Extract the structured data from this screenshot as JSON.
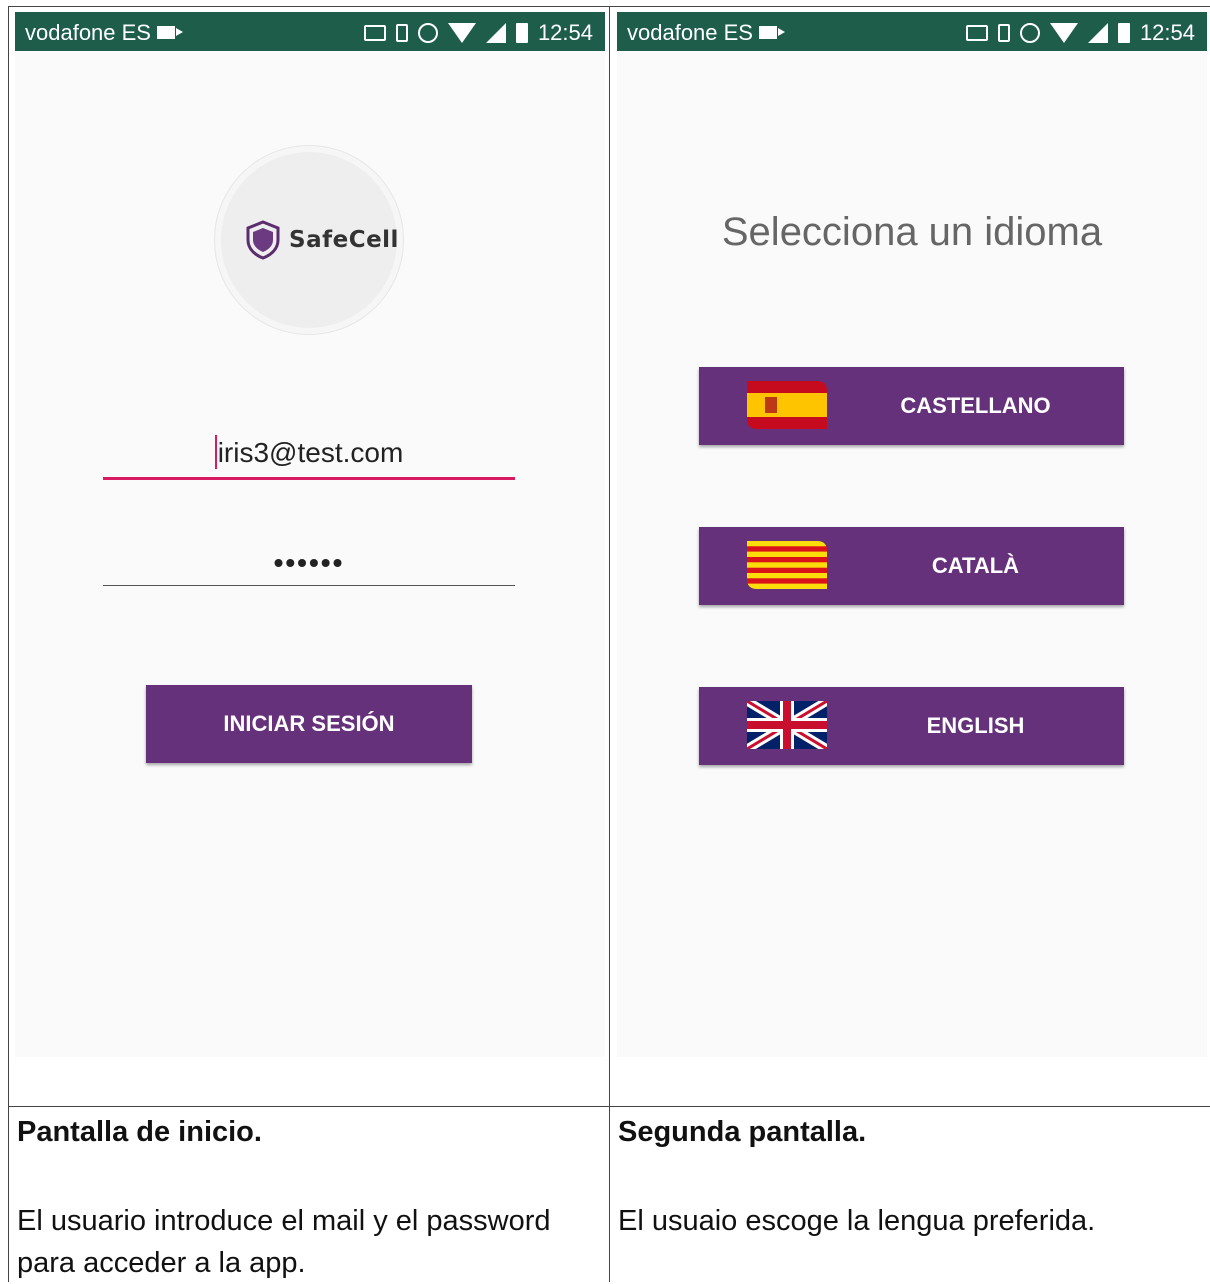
{
  "status_bar": {
    "carrier": "vodafone ES",
    "time": "12:54"
  },
  "login_screen": {
    "logo_text": "SafeCell",
    "email_value": "iris3@test.com",
    "password_value": "••••••",
    "login_button": "INICIAR SESIÓN"
  },
  "language_screen": {
    "title": "Selecciona un idioma",
    "buttons": [
      {
        "label": "CASTELLANO",
        "flag": "spain-flag-icon"
      },
      {
        "label": "CATALÀ",
        "flag": "catalonia-flag-icon"
      },
      {
        "label": "ENGLISH",
        "flag": "uk-flag-icon"
      }
    ]
  },
  "captions": {
    "left_title": "Pantalla de inicio.",
    "left_body": "El usuario introduce el mail y el password para acceder a la app.",
    "right_title": "Segunda pantalla.",
    "right_body": "El usuaio escoge la lengua preferida."
  },
  "colors": {
    "status_bar": "#1d5d4a",
    "button": "#65317a",
    "accent": "#d81b60"
  }
}
